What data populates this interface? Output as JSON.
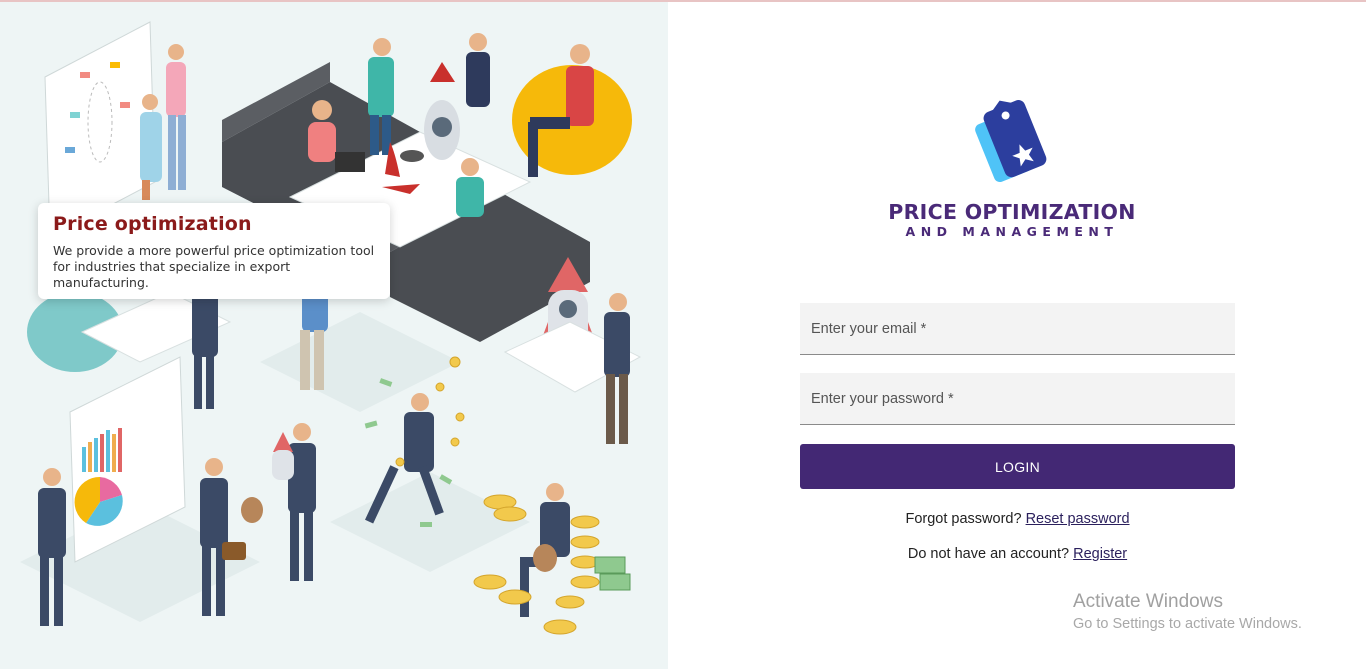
{
  "illustration": {
    "card_title": "Price optimization",
    "card_text": "We provide a more powerful price optimization tool for industries that specialize in export manufacturing."
  },
  "brand": {
    "line1": "PRICE OPTIMIZATION",
    "line2": "AND MANAGEMENT",
    "logo_icon": "price-tag-icon",
    "color": "#4a2a78"
  },
  "form": {
    "email_placeholder": "Enter your email *",
    "email_value": "",
    "password_placeholder": "Enter your password *",
    "password_value": "",
    "login_label": "LOGIN",
    "login_color": "#432874"
  },
  "links": {
    "forgot_text": "Forgot password?",
    "reset_label": "Reset password",
    "noaccount_text": "Do not have an account?",
    "register_label": "Register"
  },
  "watermark": {
    "title": "Activate Windows",
    "subtitle": "Go to Settings to activate Windows."
  }
}
